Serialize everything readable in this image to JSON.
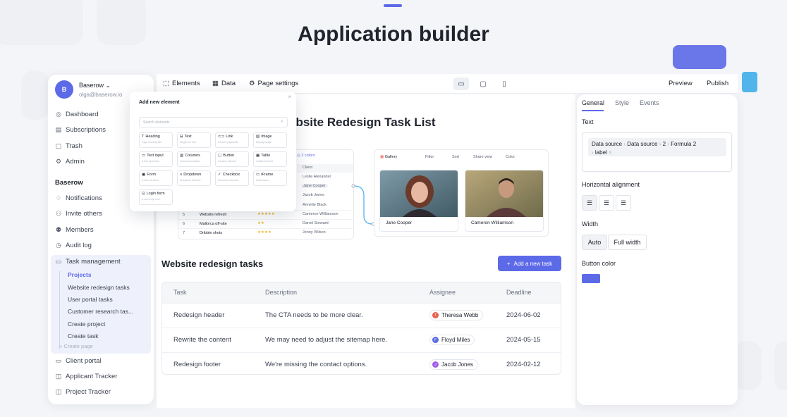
{
  "hero": {
    "title": "Application builder"
  },
  "colors": {
    "accent": "#5c6ae8",
    "button_color": "#5c6ae8"
  },
  "sidebar": {
    "workspace": "Baserow ⌄",
    "email": "olga@baserow.io",
    "avatar": "B",
    "items": [
      {
        "label": "Dashboard",
        "icon": "dashboard-icon",
        "glyph": "◎"
      },
      {
        "label": "Subscriptions",
        "icon": "subscriptions-icon",
        "glyph": "▤"
      },
      {
        "label": "Trash",
        "icon": "trash-icon",
        "glyph": "▢"
      },
      {
        "label": "Admin",
        "icon": "admin-icon",
        "glyph": "⚙"
      }
    ],
    "section": "Baserow",
    "section_items": [
      {
        "label": "Notifications",
        "icon": "bell-icon",
        "glyph": "♢"
      },
      {
        "label": "Invite others",
        "icon": "invite-icon",
        "glyph": "⚇"
      },
      {
        "label": "Members",
        "icon": "members-icon",
        "glyph": "⚉"
      },
      {
        "label": "Audit log",
        "icon": "audit-log-icon",
        "glyph": "◷"
      }
    ],
    "task_management": "Task management",
    "pages": [
      "Projects",
      "Website redesign tasks",
      "User portal tasks",
      "Customer research tas...",
      "Create project",
      "Create task"
    ],
    "create_page": "+ Create page",
    "apps": [
      {
        "label": "Client portal",
        "icon": "monitor-icon",
        "glyph": "▭"
      },
      {
        "label": "Applicant Tracker",
        "icon": "database-icon",
        "glyph": "◫"
      },
      {
        "label": "Project Tracker",
        "icon": "database-icon",
        "glyph": "◫"
      }
    ]
  },
  "toolbar": {
    "elements": "Elements",
    "data": "Data",
    "page_settings": "Page settings",
    "preview": "Preview",
    "publish": "Publish"
  },
  "canvas": {
    "heading": "ebsite Redesign Task List",
    "mini_table": {
      "colors_label": "2 colors",
      "client_header": "Client",
      "clients": [
        "Leslie Alexander",
        "Jane Cooper",
        "Jacob Jones",
        "Annette Black",
        "Cameron Williamson",
        "Darrel Steward",
        "Jenny Wilson"
      ],
      "rows": [
        {
          "n": "5",
          "name": "Website refresh",
          "stars": "★★★★★"
        },
        {
          "n": "6",
          "name": "Mallorca off-site",
          "stars": "★★"
        },
        {
          "n": "7",
          "name": "Dribble shots",
          "stars": "★★★★"
        }
      ]
    },
    "gallery": {
      "label": "Gallery",
      "tools": [
        "Filter",
        "Sort",
        "Share view",
        "Color"
      ],
      "people": [
        "Jane Cooper",
        "Cameron Williamson"
      ]
    }
  },
  "modal": {
    "title": "Add new element",
    "close": "×",
    "search_placeholder": "Search elements",
    "elements": [
      {
        "label": "Heading",
        "glyph": "T",
        "desc": "Page heading title"
      },
      {
        "label": "Text",
        "glyph": "⊟",
        "desc": "Single line text"
      },
      {
        "label": "Link",
        "glyph": "⊂⊃",
        "desc": "A link to page/URL"
      },
      {
        "label": "Image",
        "glyph": "▨",
        "desc": "Display image"
      },
      {
        "label": "Text input",
        "glyph": "▭",
        "desc": "A text input field"
      },
      {
        "label": "Columns",
        "glyph": "▥",
        "desc": "Columns container"
      },
      {
        "label": "Button",
        "glyph": "▢",
        "desc": "A button element"
      },
      {
        "label": "Table",
        "glyph": "▦",
        "desc": "A table element"
      },
      {
        "label": "Form",
        "glyph": "▣",
        "desc": "A form element"
      },
      {
        "label": "Dropdown",
        "glyph": "≡",
        "desc": "Dropdown element"
      },
      {
        "label": "Checkbox",
        "glyph": "✓",
        "desc": "Checkbox element"
      },
      {
        "label": "iFrame",
        "glyph": "▭",
        "desc": "Inline frame"
      },
      {
        "label": "Login form",
        "glyph": "⊡",
        "desc": "A user login form"
      }
    ]
  },
  "tasks": {
    "title": "Website redesign tasks",
    "add_button": "Add a new task",
    "headers": [
      "Task",
      "Description",
      "Assignee",
      "Deadline"
    ],
    "rows": [
      {
        "task": "Redesign header",
        "description": "The CTA needs to be more clear.",
        "assignee": "Theresa Webb",
        "initial": "T",
        "color": "#e8604c",
        "deadline": "2024-06-02"
      },
      {
        "task": "Rewrite the content",
        "description": "We may need to adjust the sitemap here.",
        "assignee": "Floyd Miles",
        "initial": "F",
        "color": "#5c6ae8",
        "deadline": "2024-05-15"
      },
      {
        "task": "Redesign footer",
        "description": "We're missing the contact options.",
        "assignee": "Jacob Jones",
        "initial": "J",
        "color": "#a05ce8",
        "deadline": "2024-02-12"
      }
    ]
  },
  "panel": {
    "tabs": [
      "General",
      "Style",
      "Events"
    ],
    "text_label": "Text",
    "formula": [
      "Data source",
      "Data source",
      "2",
      "Formula 2",
      "label"
    ],
    "alignment_label": "Horizontal alignment",
    "width_label": "Width",
    "width_options": [
      "Auto",
      "Full width"
    ],
    "button_color_label": "Button color"
  }
}
